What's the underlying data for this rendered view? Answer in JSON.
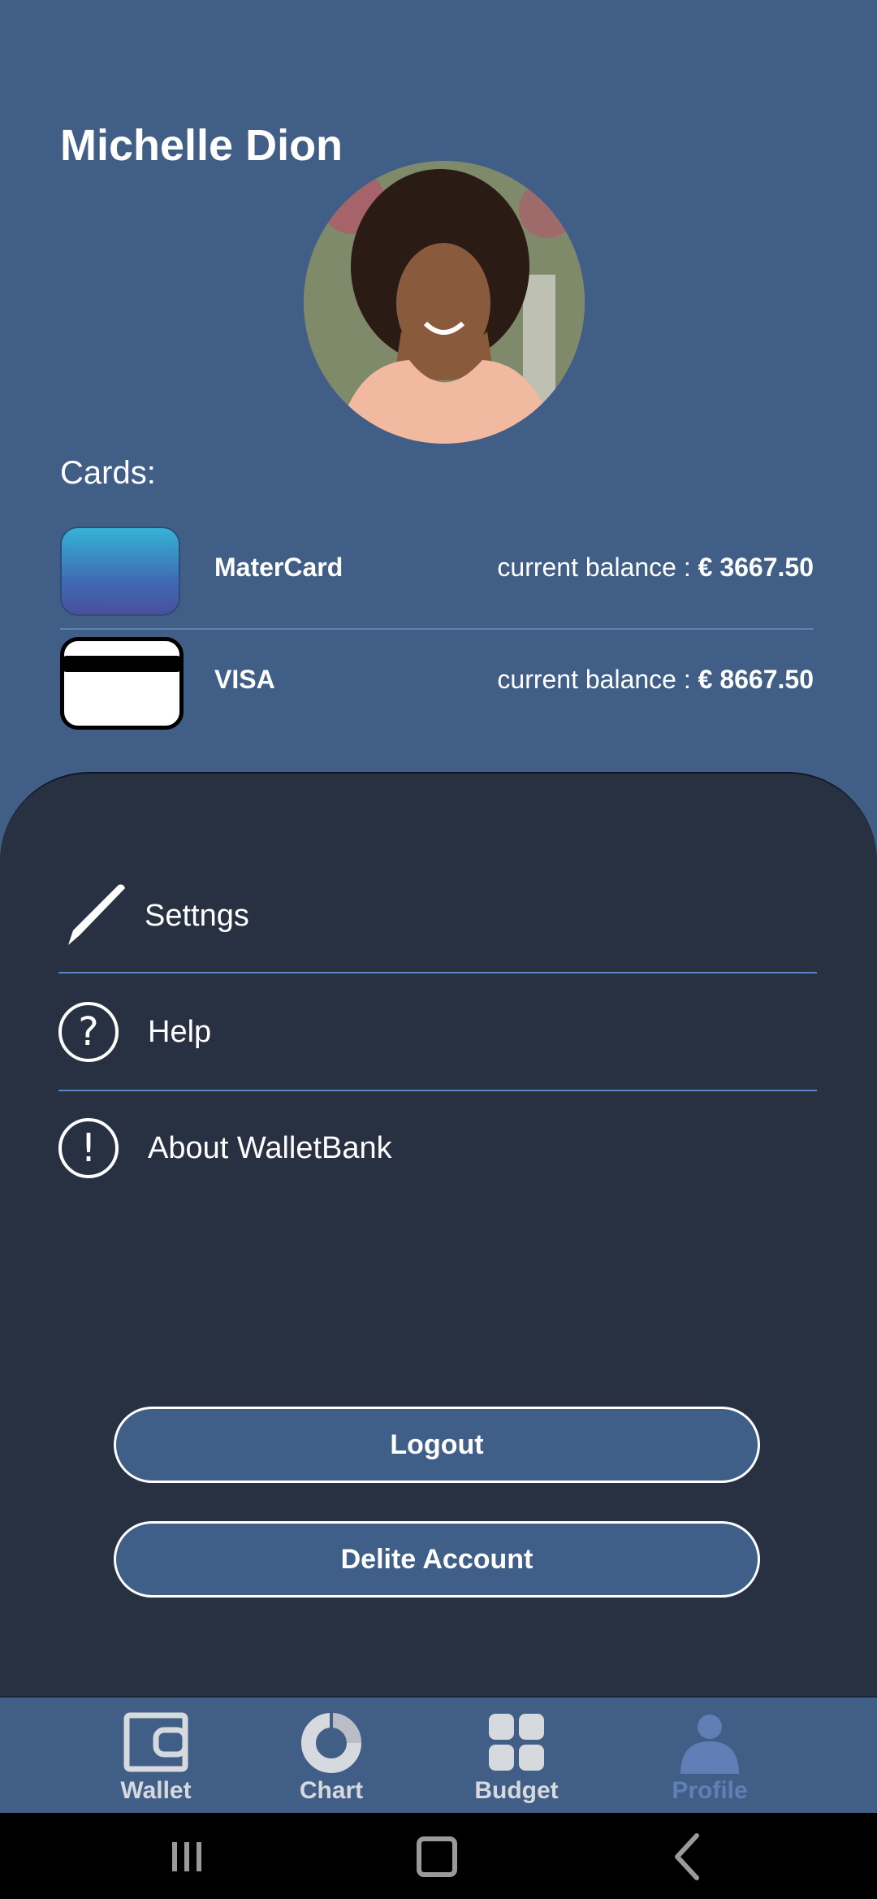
{
  "profile": {
    "name": "Michelle Dion",
    "cards_heading": "Cards:"
  },
  "cards": [
    {
      "name": "MaterCard",
      "balance_label": "current balance : ",
      "balance_value": "€ 3667.50",
      "icon": "card-mastercard-icon"
    },
    {
      "name": "VISA",
      "balance_label": "current balance : ",
      "balance_value": "€ 8667.50",
      "icon": "card-visa-icon"
    }
  ],
  "menu": {
    "settings": "Settngs",
    "help": "Help",
    "about": "About WalletBank",
    "help_glyph": "?",
    "about_glyph": "!"
  },
  "actions": {
    "logout": "Logout",
    "delete": "Delite Account"
  },
  "nav": {
    "wallet": "Wallet",
    "chart": "Chart",
    "budget": "Budget",
    "profile": "Profile",
    "active": "profile"
  },
  "colors": {
    "background": "#415E86",
    "sheet": "#283142",
    "accent": "#5F7FB6",
    "divider": "#5c84c8"
  }
}
